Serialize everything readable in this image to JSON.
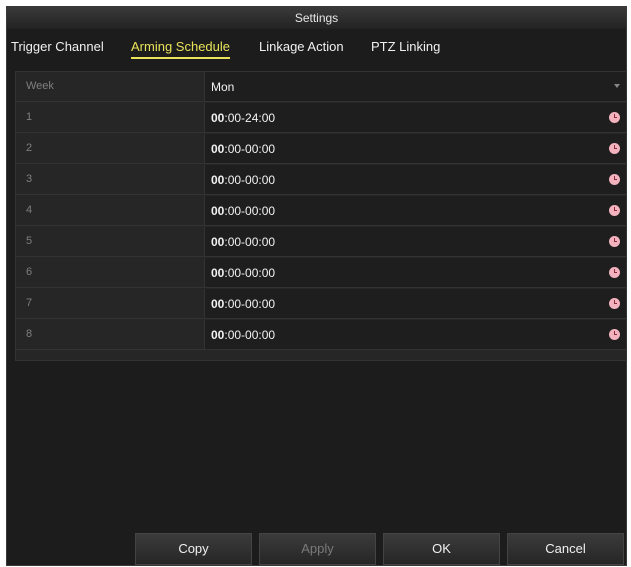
{
  "window": {
    "title": "Settings"
  },
  "tabs": [
    {
      "label": "Trigger Channel"
    },
    {
      "label": "Arming Schedule"
    },
    {
      "label": "Linkage Action"
    },
    {
      "label": "PTZ Linking"
    }
  ],
  "active_tab": "Arming Schedule",
  "week": {
    "label": "Week",
    "value": "Mon"
  },
  "schedule": [
    {
      "index": "1",
      "start_bold": "00",
      "rest": ":00-24:00"
    },
    {
      "index": "2",
      "start_bold": "00",
      "rest": ":00-00:00"
    },
    {
      "index": "3",
      "start_bold": "00",
      "rest": ":00-00:00"
    },
    {
      "index": "4",
      "start_bold": "00",
      "rest": ":00-00:00"
    },
    {
      "index": "5",
      "start_bold": "00",
      "rest": ":00-00:00"
    },
    {
      "index": "6",
      "start_bold": "00",
      "rest": ":00-00:00"
    },
    {
      "index": "7",
      "start_bold": "00",
      "rest": ":00-00:00"
    },
    {
      "index": "8",
      "start_bold": "00",
      "rest": ":00-00:00"
    }
  ],
  "buttons": {
    "copy": "Copy",
    "apply": "Apply",
    "ok": "OK",
    "cancel": "Cancel"
  },
  "colors": {
    "active_tab": "#e9e35a",
    "clock_icon": "#f2b2be",
    "background": "#1c1c1c"
  },
  "icons": [
    "dropdown-arrow-icon",
    "clock-icon"
  ]
}
